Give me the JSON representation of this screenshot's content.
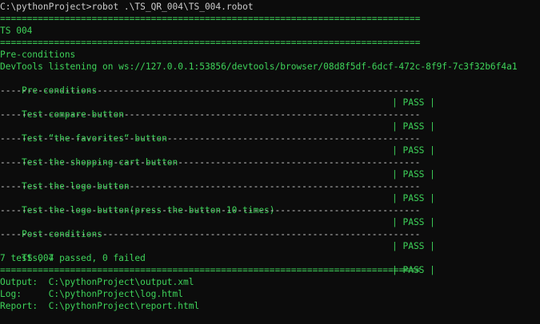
{
  "terminal": {
    "prompt": "C:\\pythonProject>robot .\\TS_QR_004\\TS_004.robot",
    "separator_double": "==============================================================================",
    "separator_single": "------------------------------------------------------------------------------",
    "suite_name": "TS 004",
    "setup_header": "Pre-conditions",
    "devtools_line": "DevTools listening on ws://127.0.0.1:53856/devtools/browser/08d8f5df-6dcf-472c-8f9f-7c3f32b6f4a1",
    "tests": [
      {
        "name": "Pre-conditions",
        "status": "| PASS |"
      },
      {
        "name": "Test compare button",
        "status": "| PASS |"
      },
      {
        "name": "Test “the favorites“ button",
        "status": "| PASS |"
      },
      {
        "name": "Test the shopping cart button",
        "status": "| PASS |"
      },
      {
        "name": "Test the logo button",
        "status": "| PASS |"
      },
      {
        "name": "Test the logo button(press the button 10 times)",
        "status": "| PASS |"
      },
      {
        "name": "Post-conditions",
        "status": "| PASS |"
      }
    ],
    "suite_result": {
      "name": "TS 004",
      "status": "| PASS |"
    },
    "summary": "7 tests, 7 passed, 0 failed",
    "outputs": {
      "output": "Output:  C:\\pythonProject\\output.xml",
      "log": "Log:     C:\\pythonProject\\log.html",
      "report": "Report:  C:\\pythonProject\\report.html"
    },
    "colors": {
      "background": "#0c0c0c",
      "text": "#cccccc",
      "green": "#3ed35a"
    }
  }
}
